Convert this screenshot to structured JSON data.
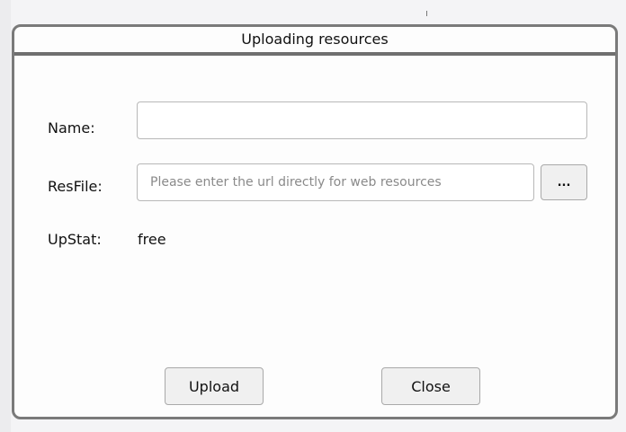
{
  "dialog": {
    "title": "Uploading resources"
  },
  "form": {
    "name_label": "Name:",
    "name_value": "",
    "resfile_label": "ResFile:",
    "resfile_value": "",
    "resfile_placeholder": "Please enter the url directly for web resources",
    "browse_label": "...",
    "upstat_label": "UpStat:",
    "upstat_value": "free"
  },
  "buttons": {
    "upload_label": "Upload",
    "close_label": "Close"
  }
}
